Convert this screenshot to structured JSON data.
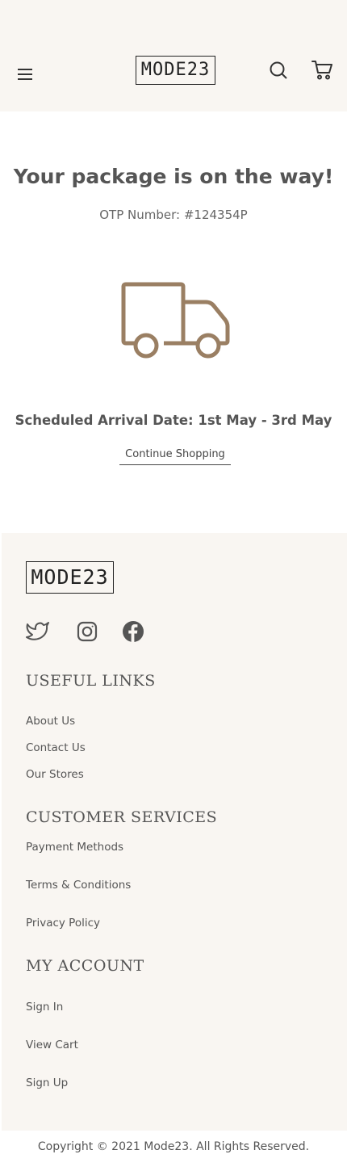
{
  "header": {
    "logo": "MODE23",
    "menu_icon": "hamburger-menu-icon",
    "search_icon": "search-icon",
    "cart_icon": "shopping-cart-icon"
  },
  "main": {
    "title": "Your package is on the way!",
    "otp": "OTP Number: #124354P",
    "truck_icon": "delivery-truck-icon",
    "arrival": "Scheduled Arrival Date: 1st May - 3rd May",
    "continue_label": "Continue Shopping"
  },
  "footer": {
    "logo": "MODE23",
    "social": [
      "twitter-icon",
      "instagram-icon",
      "facebook-icon"
    ],
    "useful_links": {
      "title": "USEFUL LINKS",
      "items": [
        "About Us",
        "Contact Us",
        "Our Stores"
      ]
    },
    "customer_services": {
      "title": "CUSTOMER SERVICES",
      "items": [
        "Payment Methods",
        "Terms & Conditions",
        "Privacy Policy"
      ]
    },
    "my_account": {
      "title": "MY ACCOUNT",
      "items": [
        "Sign In",
        "View Cart",
        "Sign Up"
      ]
    },
    "copyright": "Copyright © 2021 Mode23. All Rights Reserved."
  },
  "colors": {
    "accent": "#9a7f63",
    "background_tint": "#f9f6f2",
    "text": "#555555"
  }
}
